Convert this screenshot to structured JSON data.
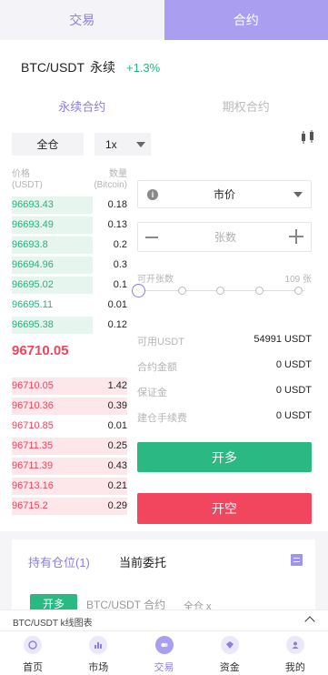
{
  "top_tabs": [
    {
      "label": "交易"
    },
    {
      "label": "合约"
    }
  ],
  "pair": {
    "symbol": "BTC/USDT",
    "type": "永续",
    "change": "+1.3%"
  },
  "sub_tabs": [
    {
      "label": "永续合约"
    },
    {
      "label": "期权合约"
    }
  ],
  "margin_mode": "全仓",
  "leverage": "1x",
  "order_book": {
    "price_header": "价格",
    "price_unit": "(USDT)",
    "qty_header": "数量",
    "qty_unit": "(Bitcoin)",
    "buys": [
      {
        "price": "96693.43",
        "qty": "0.18",
        "depth": 0.7
      },
      {
        "price": "96693.49",
        "qty": "0.13",
        "depth": 0.7
      },
      {
        "price": "96693.8",
        "qty": "0.2",
        "depth": 0.7
      },
      {
        "price": "96694.96",
        "qty": "0.3",
        "depth": 0.7
      },
      {
        "price": "96695.02",
        "qty": "0.1",
        "depth": 0.7
      },
      {
        "price": "96695.11",
        "qty": "0.01",
        "depth": 0.0
      },
      {
        "price": "96695.38",
        "qty": "0.12",
        "depth": 0.7
      }
    ],
    "last_price": "96710.05",
    "sells": [
      {
        "price": "96710.05",
        "qty": "1.42",
        "depth": 1.0
      },
      {
        "price": "96710.36",
        "qty": "0.39",
        "depth": 1.0
      },
      {
        "price": "96710.85",
        "qty": "0.01",
        "depth": 0.0
      },
      {
        "price": "96711.35",
        "qty": "0.25",
        "depth": 1.0
      },
      {
        "price": "96711.39",
        "qty": "0.43",
        "depth": 1.0
      },
      {
        "price": "96713.16",
        "qty": "0.21",
        "depth": 1.0
      },
      {
        "price": "96715.2",
        "qty": "0.29",
        "depth": 1.0
      }
    ]
  },
  "order_form": {
    "order_type": "市价",
    "qty_placeholder": "张数",
    "open_label": "可开张数",
    "open_max": "109 张",
    "slider_level": 0,
    "info": [
      {
        "key": "可用USDT",
        "value": "54991 USDT"
      },
      {
        "key": "合约金额",
        "value": "0 USDT"
      },
      {
        "key": "保证金",
        "value": "0 USDT"
      },
      {
        "key": "建仓手续费",
        "value": "0 USDT"
      }
    ],
    "long_label": "开多",
    "short_label": "开空"
  },
  "positions": {
    "tab_holdings": "持有仓位(1)",
    "tab_orders": "当前委托",
    "item_badge": "开多",
    "item_symbol": "BTC/USDT 合约",
    "item_mode": "全仓 x"
  },
  "kline_strip": "BTC/USDT k线图表",
  "nav": [
    {
      "label": "首页"
    },
    {
      "label": "市场"
    },
    {
      "label": "交易"
    },
    {
      "label": "资金"
    },
    {
      "label": "我的"
    }
  ],
  "colors": {
    "accent": "#a99ef0",
    "up": "#2bb983",
    "down": "#f2455e"
  }
}
